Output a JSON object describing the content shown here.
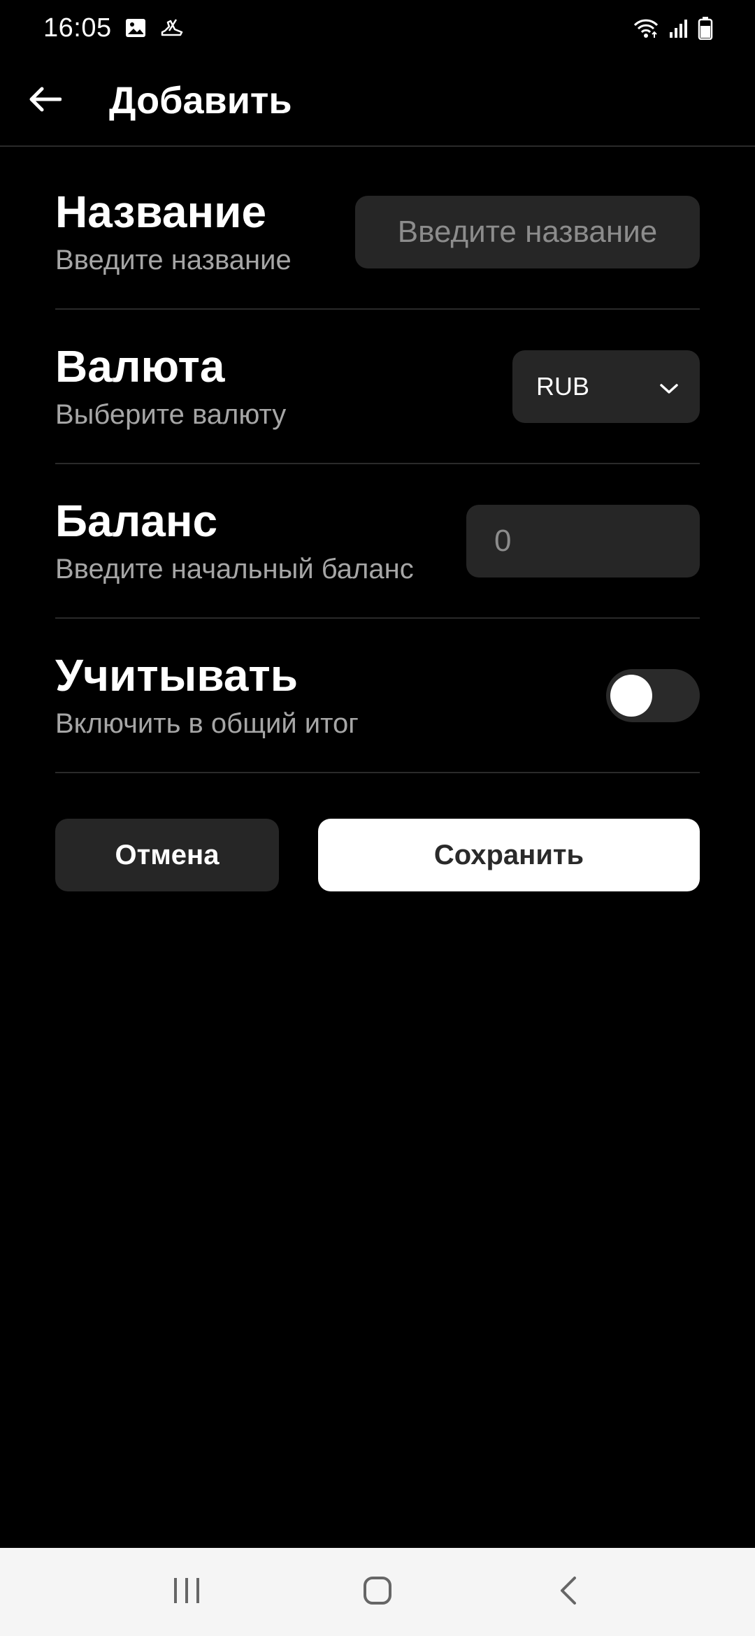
{
  "status_bar": {
    "time": "16:05",
    "icons_left": [
      "image-icon",
      "sneaker-icon"
    ],
    "icons_right": [
      "wifi-icon",
      "signal-icon",
      "battery-icon"
    ]
  },
  "app_bar": {
    "title": "Добавить",
    "back_icon": "arrow-left-icon"
  },
  "form": {
    "name": {
      "title": "Название",
      "subtitle": "Введите название",
      "placeholder": "Введите название",
      "value": ""
    },
    "currency": {
      "title": "Валюта",
      "subtitle": "Выберите валюту",
      "selected": "RUB"
    },
    "balance": {
      "title": "Баланс",
      "subtitle": "Введите начальный баланс",
      "placeholder": "0",
      "value": ""
    },
    "include": {
      "title": "Учитывать",
      "subtitle": "Включить в общий итог",
      "enabled": false
    }
  },
  "actions": {
    "cancel_label": "Отмена",
    "save_label": "Сохранить"
  },
  "nav_bar": {
    "icons": [
      "recent-apps-icon",
      "home-icon",
      "back-icon"
    ]
  },
  "colors": {
    "background": "#000000",
    "surface": "#262626",
    "divider": "#2a2a2a",
    "text_primary": "#ffffff",
    "text_secondary": "#a6a6a6",
    "save_button_bg": "#ffffff"
  }
}
